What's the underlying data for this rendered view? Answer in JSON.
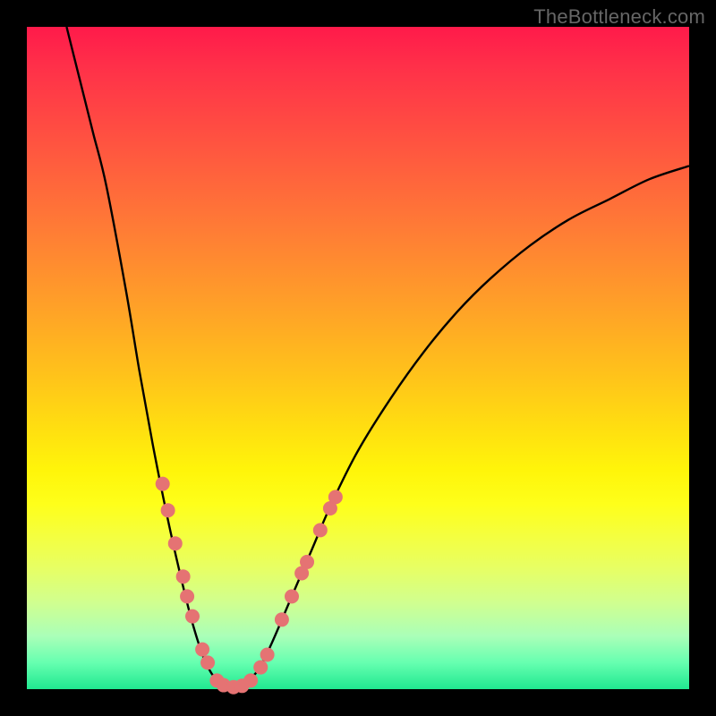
{
  "watermark": "TheBottleneck.com",
  "colors": {
    "curve_stroke": "#000000",
    "dot_fill": "#e57373",
    "dot_stroke": "#c94f4f"
  },
  "chart_data": {
    "type": "line",
    "title": "",
    "xlabel": "",
    "ylabel": "",
    "xlim": [
      0,
      100
    ],
    "ylim": [
      0,
      100
    ],
    "curve_points": [
      {
        "x": 6,
        "y": 100
      },
      {
        "x": 8,
        "y": 92
      },
      {
        "x": 10,
        "y": 84
      },
      {
        "x": 12,
        "y": 76
      },
      {
        "x": 15,
        "y": 60
      },
      {
        "x": 17,
        "y": 48
      },
      {
        "x": 19,
        "y": 37
      },
      {
        "x": 21,
        "y": 27
      },
      {
        "x": 23,
        "y": 18
      },
      {
        "x": 25,
        "y": 10
      },
      {
        "x": 27,
        "y": 4
      },
      {
        "x": 29,
        "y": 1
      },
      {
        "x": 31,
        "y": 0
      },
      {
        "x": 33,
        "y": 1
      },
      {
        "x": 35,
        "y": 3
      },
      {
        "x": 37,
        "y": 7
      },
      {
        "x": 40,
        "y": 14
      },
      {
        "x": 43,
        "y": 21
      },
      {
        "x": 46,
        "y": 28
      },
      {
        "x": 50,
        "y": 36
      },
      {
        "x": 55,
        "y": 44
      },
      {
        "x": 60,
        "y": 51
      },
      {
        "x": 65,
        "y": 57
      },
      {
        "x": 70,
        "y": 62
      },
      {
        "x": 76,
        "y": 67
      },
      {
        "x": 82,
        "y": 71
      },
      {
        "x": 88,
        "y": 74
      },
      {
        "x": 94,
        "y": 77
      },
      {
        "x": 100,
        "y": 79
      }
    ],
    "dot_points": [
      {
        "x": 20.5,
        "y": 31
      },
      {
        "x": 21.3,
        "y": 27
      },
      {
        "x": 22.4,
        "y": 22
      },
      {
        "x": 23.6,
        "y": 17
      },
      {
        "x": 24.2,
        "y": 14
      },
      {
        "x": 25.0,
        "y": 11
      },
      {
        "x": 26.5,
        "y": 6
      },
      {
        "x": 27.3,
        "y": 4
      },
      {
        "x": 28.7,
        "y": 1.3
      },
      {
        "x": 29.7,
        "y": 0.6
      },
      {
        "x": 31.2,
        "y": 0.3
      },
      {
        "x": 32.5,
        "y": 0.5
      },
      {
        "x": 33.8,
        "y": 1.3
      },
      {
        "x": 35.3,
        "y": 3.3
      },
      {
        "x": 36.3,
        "y": 5.2
      },
      {
        "x": 38.5,
        "y": 10.5
      },
      {
        "x": 40.0,
        "y": 14.0
      },
      {
        "x": 41.5,
        "y": 17.5
      },
      {
        "x": 42.3,
        "y": 19.2
      },
      {
        "x": 44.3,
        "y": 24.0
      },
      {
        "x": 45.8,
        "y": 27.3
      },
      {
        "x": 46.6,
        "y": 29.0
      }
    ]
  }
}
